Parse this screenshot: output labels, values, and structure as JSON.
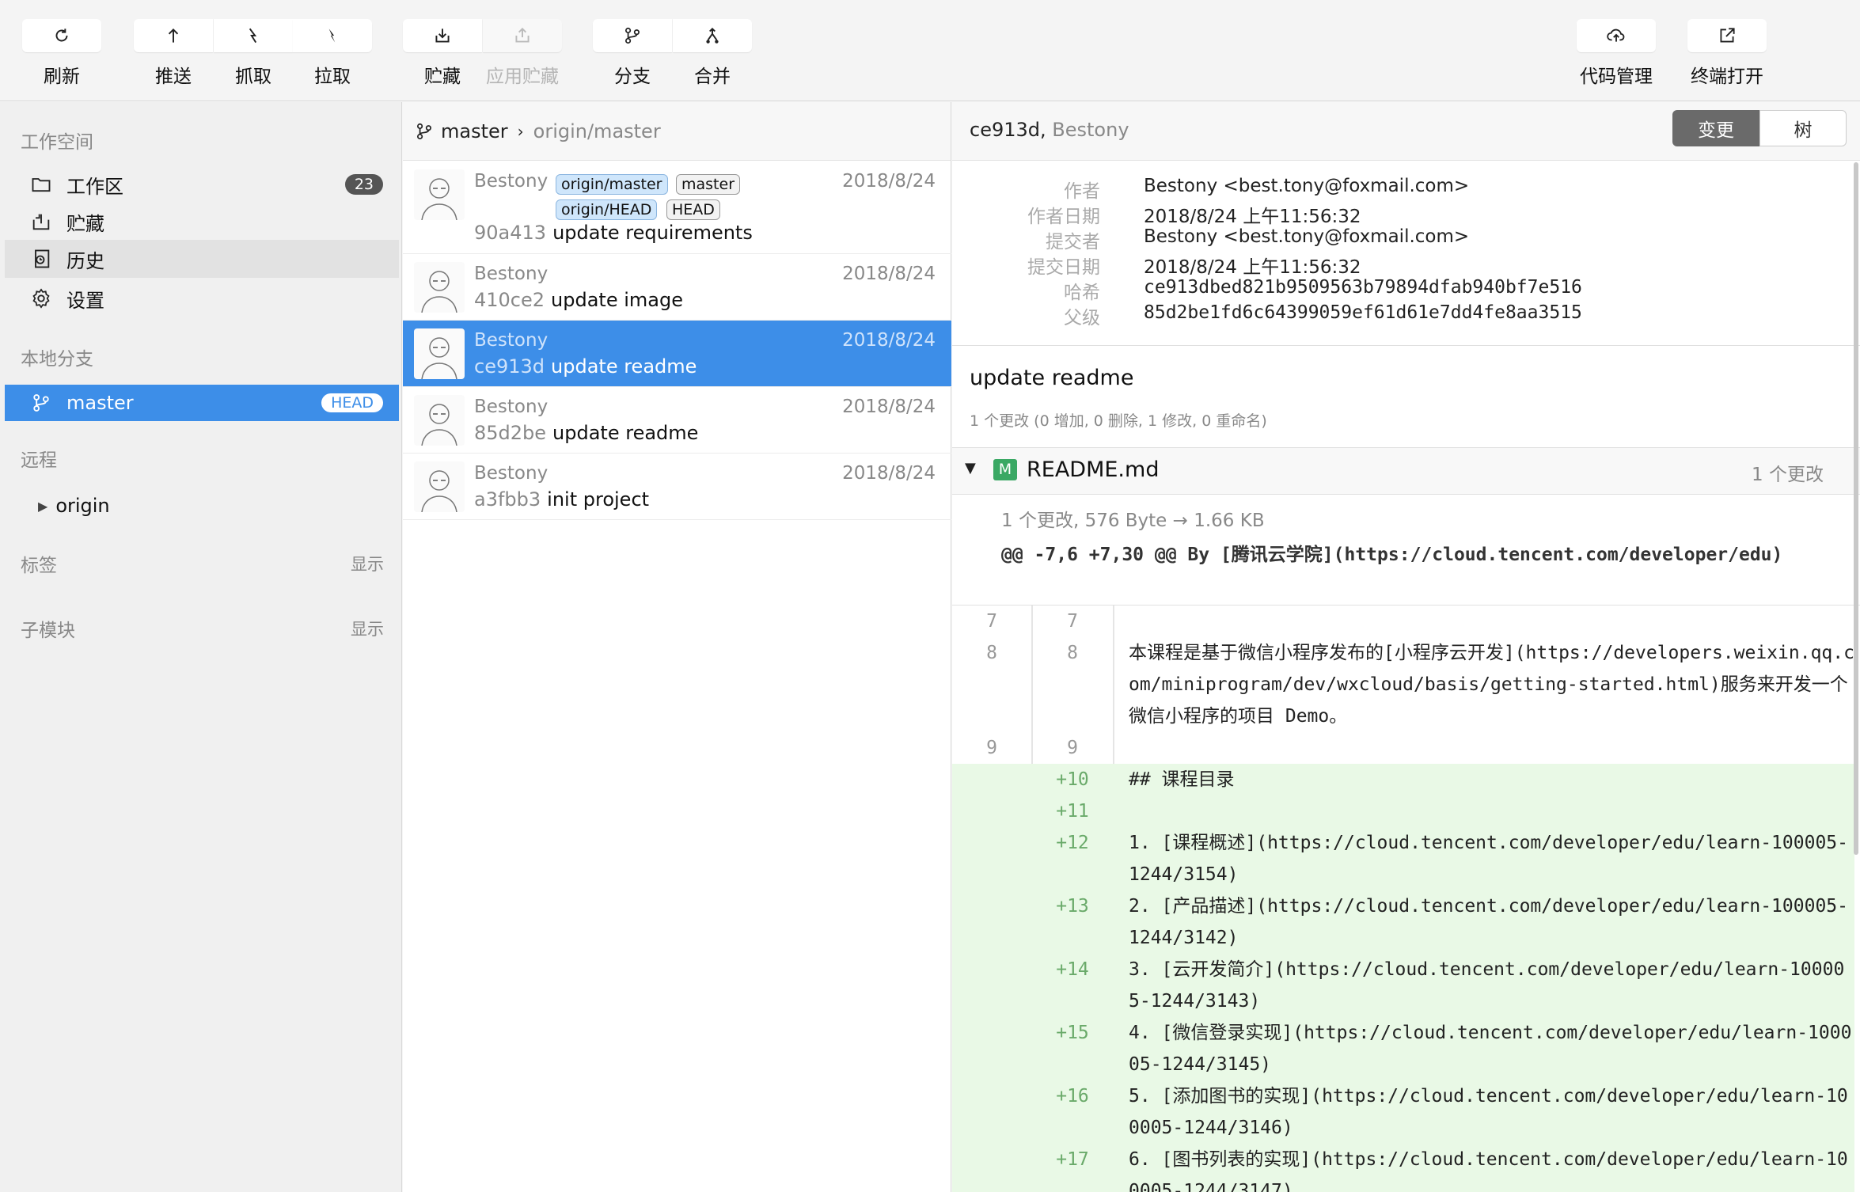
{
  "toolbar": {
    "refresh": "刷新",
    "push": "推送",
    "fetch": "抓取",
    "pull": "拉取",
    "stash": "贮藏",
    "apply_stash": "应用贮藏",
    "branch": "分支",
    "merge": "合并",
    "code_manage": "代码管理",
    "terminal": "终端打开"
  },
  "sidebar": {
    "workspace_title": "工作空间",
    "workspace_items": [
      {
        "label": "工作区",
        "count": "23"
      },
      {
        "label": "贮藏"
      },
      {
        "label": "历史"
      },
      {
        "label": "设置"
      }
    ],
    "local_branches_title": "本地分支",
    "local_branch": {
      "name": "master",
      "badge": "HEAD"
    },
    "remote_title": "远程",
    "remote_item": "origin",
    "tags_title": "标签",
    "tags_action": "显示",
    "submodules_title": "子模块",
    "submodules_action": "显示"
  },
  "commit_list": {
    "branch": "master",
    "upstream": "origin/master",
    "commits": [
      {
        "author": "Bestony",
        "date": "2018/8/24",
        "hash": "90a413",
        "message": "update requirements",
        "refs": [
          "origin/master",
          "master",
          "origin/HEAD",
          "HEAD"
        ]
      },
      {
        "author": "Bestony",
        "date": "2018/8/24",
        "hash": "410ce2",
        "message": "update image"
      },
      {
        "author": "Bestony",
        "date": "2018/8/24",
        "hash": "ce913d",
        "message": "update readme"
      },
      {
        "author": "Bestony",
        "date": "2018/8/24",
        "hash": "85d2be",
        "message": "update readme"
      },
      {
        "author": "Bestony",
        "date": "2018/8/24",
        "hash": "a3fbb3",
        "message": "init project"
      }
    ]
  },
  "detail": {
    "header_hash": "ce913d,",
    "header_author": "Bestony",
    "tab_changes": "变更",
    "tab_tree": "树",
    "meta": [
      {
        "key": "作者",
        "value": "Bestony <best.tony@foxmail.com>"
      },
      {
        "key": "作者日期",
        "value": "2018/8/24 上午11:56:32"
      },
      {
        "key": "提交者",
        "value": "Bestony <best.tony@foxmail.com>"
      },
      {
        "key": "提交日期",
        "value": "2018/8/24 上午11:56:32"
      },
      {
        "key": "哈希",
        "value": "ce913dbed821b9509563b79894dfab940bf7e516"
      },
      {
        "key": "父级",
        "value": "85d2be1fd6c64399059ef61d61e7dd4fe8aa3515"
      }
    ],
    "subject": "update readme",
    "summary": "1 个更改 (0 增加, 0 删除, 1 修改, 0 重命名)",
    "file": {
      "status": "M",
      "name": "README.md",
      "changes": "1 个更改"
    },
    "file_stats": "1 个更改, 576 Byte → 1.66 KB",
    "hunk_header": "@@ -7,6 +7,30 @@ By [腾讯云学院](https://cloud.tencent.com/developer/edu)",
    "diff_lines": [
      {
        "old": "7",
        "new": "7",
        "text": ""
      },
      {
        "old": "8",
        "new": "8",
        "text": "本课程是基于微信小程序发布的[小程序云开发](https://developers.weixin.qq.com/miniprogram/dev/wxcloud/basis/getting-started.html)服务来开发一个微信小程序的项目 Demo。"
      },
      {
        "old": "9",
        "new": "9",
        "text": ""
      },
      {
        "old": "",
        "new": "+10",
        "text": "## 课程目录"
      },
      {
        "old": "",
        "new": "+11",
        "text": ""
      },
      {
        "old": "",
        "new": "+12",
        "text": "1. [课程概述](https://cloud.tencent.com/developer/edu/learn-100005-1244/3154)"
      },
      {
        "old": "",
        "new": "+13",
        "text": "2. [产品描述](https://cloud.tencent.com/developer/edu/learn-100005-1244/3142)"
      },
      {
        "old": "",
        "new": "+14",
        "text": "3. [云开发简介](https://cloud.tencent.com/developer/edu/learn-100005-1244/3143)"
      },
      {
        "old": "",
        "new": "+15",
        "text": "4. [微信登录实现](https://cloud.tencent.com/developer/edu/learn-100005-1244/3145)"
      },
      {
        "old": "",
        "new": "+16",
        "text": "5. [添加图书的实现](https://cloud.tencent.com/developer/edu/learn-100005-1244/3146)"
      },
      {
        "old": "",
        "new": "+17",
        "text": "6. [图书列表的实现](https://cloud.tencent.com/developer/edu/learn-100005-1244/3147)"
      }
    ]
  },
  "colors": {
    "accent": "#3d8ee8",
    "added_bg": "#e9f9e6",
    "modified_badge": "#3aa864"
  }
}
